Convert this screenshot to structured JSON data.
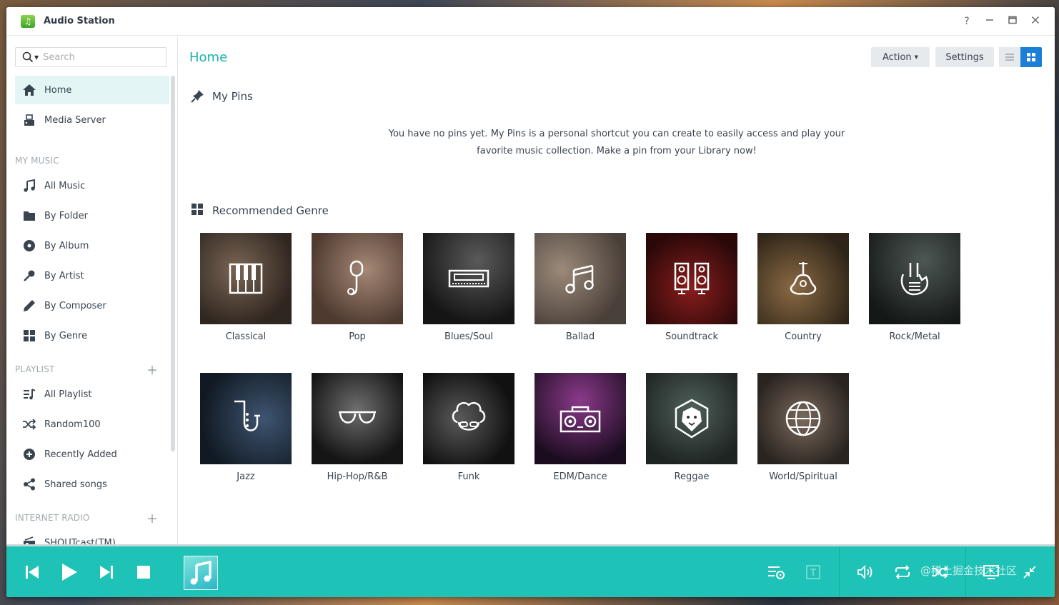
{
  "window": {
    "title": "Audio Station"
  },
  "search": {
    "placeholder": "Search"
  },
  "sidebar": {
    "items": [
      {
        "label": "Home",
        "icon": "home-icon",
        "active": true
      },
      {
        "label": "Media Server",
        "icon": "media-server-icon"
      }
    ],
    "my_music_header": "MY MUSIC",
    "my_music": [
      {
        "label": "All Music",
        "icon": "music-note-icon"
      },
      {
        "label": "By Folder",
        "icon": "folder-icon"
      },
      {
        "label": "By Album",
        "icon": "album-icon"
      },
      {
        "label": "By Artist",
        "icon": "microphone-icon"
      },
      {
        "label": "By Composer",
        "icon": "pen-icon"
      },
      {
        "label": "By Genre",
        "icon": "grid-icon"
      }
    ],
    "playlist_header": "PLAYLIST",
    "playlist": [
      {
        "label": "All Playlist",
        "icon": "playlist-icon"
      },
      {
        "label": "Random100",
        "icon": "shuffle-icon"
      },
      {
        "label": "Recently Added",
        "icon": "plus-circle-icon"
      },
      {
        "label": "Shared songs",
        "icon": "share-icon"
      }
    ],
    "radio_header": "INTERNET RADIO",
    "radio": [
      {
        "label": "SHOUTcast(TM)",
        "icon": "radio-icon"
      }
    ]
  },
  "main": {
    "title": "Home",
    "action_label": "Action",
    "settings_label": "Settings",
    "pins_title": "My Pins",
    "pins_empty_line1": "You have no pins yet. My Pins is a personal shortcut you can create to easily access and play your",
    "pins_empty_line2": "favorite music collection. Make a pin from your Library now!",
    "genre_title": "Recommended Genre",
    "genres": [
      {
        "name": "Classical"
      },
      {
        "name": "Pop"
      },
      {
        "name": "Blues/Soul"
      },
      {
        "name": "Ballad"
      },
      {
        "name": "Soundtrack"
      },
      {
        "name": "Country"
      },
      {
        "name": "Rock/Metal"
      },
      {
        "name": "Jazz"
      },
      {
        "name": "Hip-Hop/R&B"
      },
      {
        "name": "Funk"
      },
      {
        "name": "EDM/Dance"
      },
      {
        "name": "Reggae"
      },
      {
        "name": "World/Spiritual"
      }
    ]
  },
  "colors": {
    "accent": "#19b3ad",
    "player_bg": "#1fc2b6"
  },
  "watermark": "@稀土掘金技术社区"
}
